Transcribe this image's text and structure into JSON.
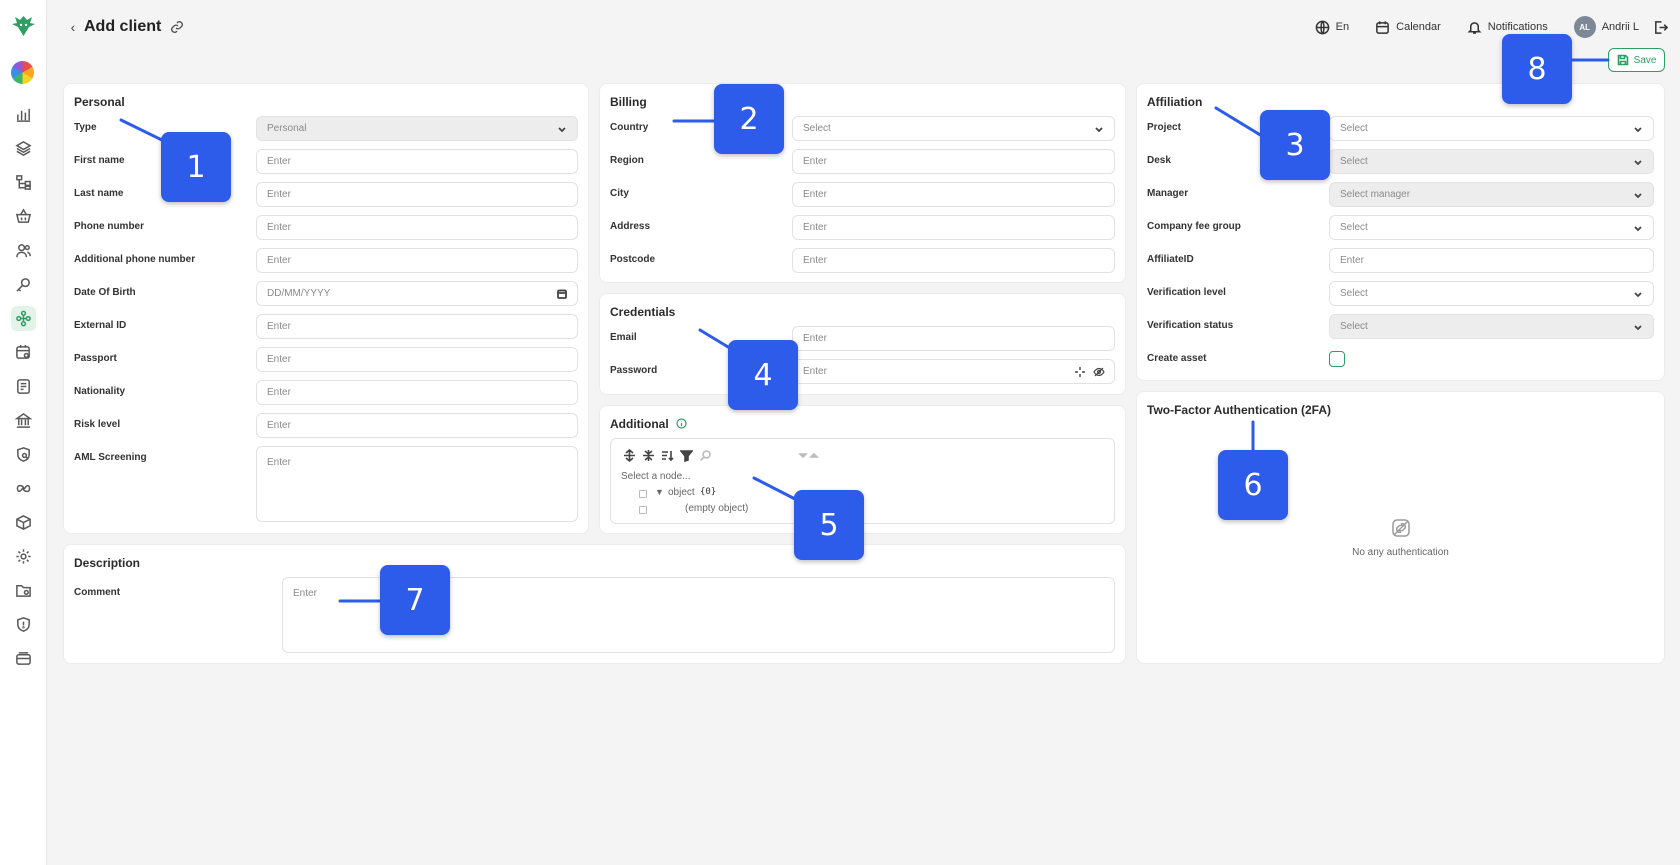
{
  "app": {
    "title": "Add client",
    "language": "En",
    "calendar_label": "Calendar",
    "notifications_label": "Notifications",
    "user_initials": "AL",
    "user_name": "Andrii L",
    "save_label": "Save",
    "accent_color": "#2e9e63",
    "callout_color": "#2d5bea"
  },
  "sidebar": {
    "icons": [
      "brand-logo-icon",
      "color-wheel-icon",
      "bar-chart-icon",
      "layers-icon",
      "hierarchy-icon",
      "basket-icon",
      "users-icon",
      "key-icon",
      "network-icon",
      "calendar-gear-icon",
      "notes-icon",
      "bank-icon",
      "shield-search-icon",
      "infinity-icon",
      "cube-icon",
      "settings-icon",
      "folder-gear-icon",
      "shield-icon",
      "cards-icon"
    ],
    "active": "network-icon"
  },
  "personal": {
    "title": "Personal",
    "rows": [
      {
        "label": "Type",
        "value": "Personal",
        "kind": "select-disabled"
      },
      {
        "label": "First name",
        "value": "Enter",
        "kind": "input"
      },
      {
        "label": "Last name",
        "value": "Enter",
        "kind": "input"
      },
      {
        "label": "Phone number",
        "value": "Enter",
        "kind": "input"
      },
      {
        "label": "Additional phone number",
        "value": "Enter",
        "kind": "input"
      },
      {
        "label": "Date Of Birth",
        "value": "DD/MM/YYYY",
        "kind": "date"
      },
      {
        "label": "External ID",
        "value": "Enter",
        "kind": "input"
      },
      {
        "label": "Passport",
        "value": "Enter",
        "kind": "input"
      },
      {
        "label": "Nationality",
        "value": "Enter",
        "kind": "input"
      },
      {
        "label": "Risk level",
        "value": "Enter",
        "kind": "input"
      },
      {
        "label": "AML Screening",
        "value": "Enter",
        "kind": "textarea"
      }
    ]
  },
  "billing": {
    "title": "Billing",
    "rows": [
      {
        "label": "Country",
        "value": "Select",
        "kind": "select"
      },
      {
        "label": "Region",
        "value": "Enter",
        "kind": "input"
      },
      {
        "label": "City",
        "value": "Enter",
        "kind": "input"
      },
      {
        "label": "Address",
        "value": "Enter",
        "kind": "input"
      },
      {
        "label": "Postcode",
        "value": "Enter",
        "kind": "input"
      }
    ]
  },
  "credentials": {
    "title": "Credentials",
    "rows": [
      {
        "label": "Email",
        "value": "Enter",
        "kind": "input"
      },
      {
        "label": "Password",
        "value": "Enter",
        "kind": "password"
      }
    ]
  },
  "additional": {
    "title": "Additional",
    "select_node": "Select a node...",
    "object_label": "object",
    "object_count": "{0}",
    "empty_object": "(empty object)"
  },
  "affiliation": {
    "title": "Affiliation",
    "rows": [
      {
        "label": "Project",
        "value": "Select",
        "kind": "select"
      },
      {
        "label": "Desk",
        "value": "Select",
        "kind": "select-disabled"
      },
      {
        "label": "Manager",
        "value": "Select manager",
        "kind": "select-disabled"
      },
      {
        "label": "Company fee group",
        "value": "Select",
        "kind": "select"
      },
      {
        "label": "AffiliateID",
        "value": "Enter",
        "kind": "input"
      },
      {
        "label": "Verification level",
        "value": "Select",
        "kind": "select"
      },
      {
        "label": "Verification status",
        "value": "Select",
        "kind": "select-disabled"
      },
      {
        "label": "Create asset",
        "value": "",
        "kind": "checkbox"
      }
    ]
  },
  "twofa": {
    "title": "Two-Factor Authentication (2FA)",
    "empty_text": "No any authentication"
  },
  "description": {
    "title": "Description",
    "comment_label": "Comment",
    "comment_placeholder": "Enter"
  },
  "callouts": [
    "1",
    "2",
    "3",
    "4",
    "5",
    "6",
    "7",
    "8"
  ]
}
